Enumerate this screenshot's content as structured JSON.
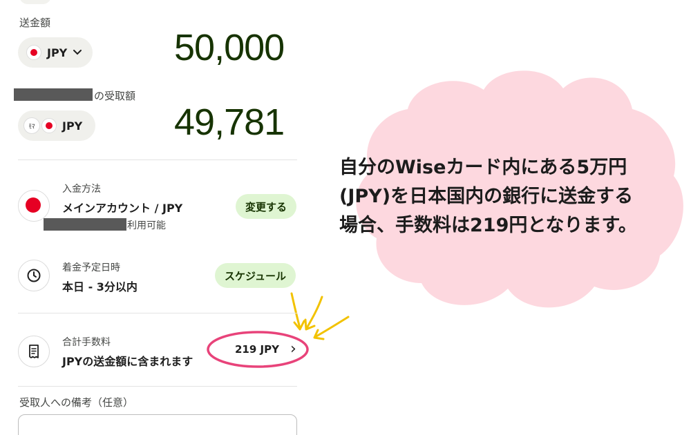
{
  "send": {
    "label": "送金額",
    "currency": "JPY",
    "amount": "50,000"
  },
  "receive": {
    "label_suffix": "の受取額",
    "wise_badge": "ﾓﾏ",
    "currency": "JPY",
    "amount": "49,781"
  },
  "payment_method": {
    "title": "入金方法",
    "value": "メインアカウント / JPY",
    "available_suffix": "利用可能",
    "button": "変更する"
  },
  "arrival": {
    "title": "着金予定日時",
    "value": "本日 - 3分以内",
    "button": "スケジュール"
  },
  "fee": {
    "title": "合計手数料",
    "value": "JPYの送金額に含まれます",
    "amount": "219 JPY",
    "chevron": "›"
  },
  "note": {
    "label": "受取人への備考（任意）"
  },
  "annotation": {
    "lines": [
      "自分のWiseカード内にある5万円",
      "(JPY)を日本国内の銀行に送金する",
      "場合、手数料は219円となります。"
    ]
  },
  "colors": {
    "amount": "#163300",
    "button_bg": "#dff5d2",
    "flag_red": "#e60023",
    "cloud": "#fdd8df",
    "highlight_circle": "#e8437a",
    "arrows": "#f2c200"
  },
  "icons": [
    "japan-flag-icon",
    "chevron-down-icon",
    "clock-icon",
    "receipt-icon",
    "chevron-right-icon"
  ]
}
